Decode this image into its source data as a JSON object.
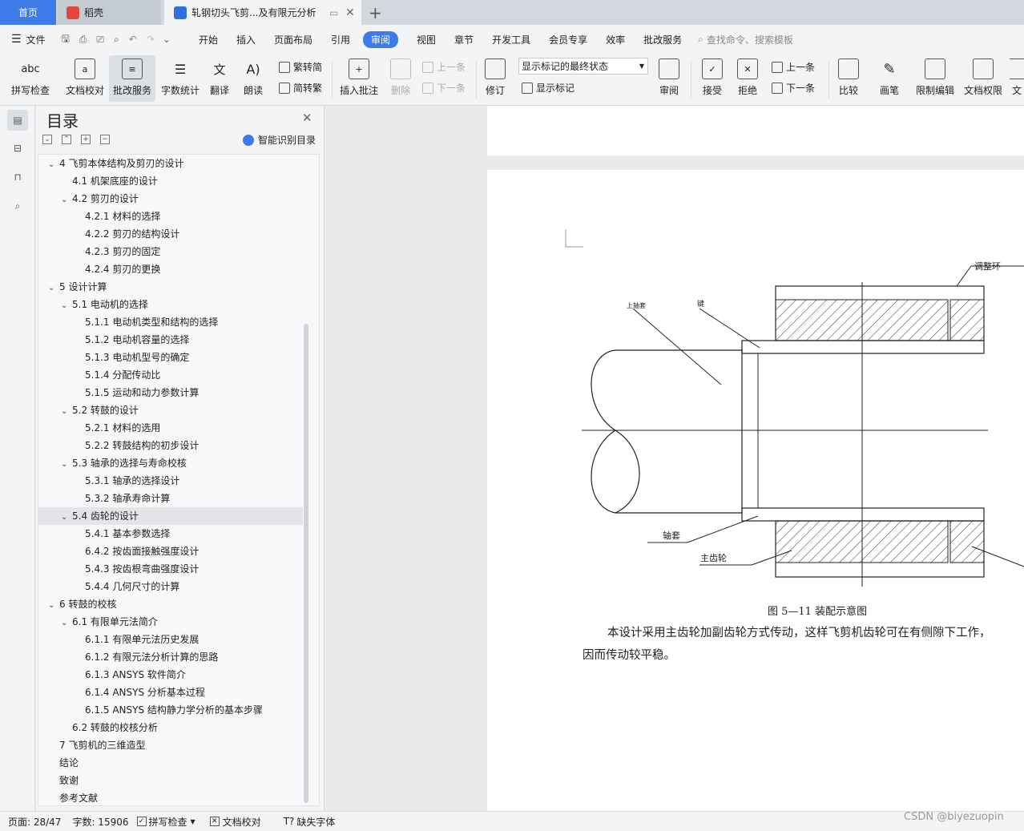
{
  "tabs": {
    "home": "首页",
    "wps": "稻壳",
    "doc": "轧钢切头飞剪...及有限元分析"
  },
  "menu": {
    "file": "文件",
    "items": [
      "开始",
      "插入",
      "页面布局",
      "引用",
      "审阅",
      "视图",
      "章节",
      "开发工具",
      "会员专享",
      "效率",
      "批改服务"
    ],
    "active_index": 4,
    "search_placeholder": "查找命令、搜索模板"
  },
  "ribbon": {
    "spell": "拼写检查",
    "doc_check": "文档校对",
    "revise_service": "批改服务",
    "word_count": "字数统计",
    "translate": "翻译",
    "read": "朗读",
    "trad_to_simp": "繁转简",
    "simp_to_trad": "简转繁",
    "insert_comment": "插入批注",
    "delete": "删除",
    "prev": "上一条",
    "next": "下一条",
    "track": "修订",
    "markup_state": "显示标记的最终状态",
    "show_markup": "显示标记",
    "review": "审阅",
    "accept": "接受",
    "reject": "拒绝",
    "prev2": "上一条",
    "next2": "下一条",
    "compare": "比较",
    "pen": "画笔",
    "restrict": "限制编辑",
    "doc_perm": "文档权限",
    "doc_more": "文"
  },
  "toc": {
    "title": "目录",
    "smart": "智能识别目录",
    "items": [
      {
        "text": "4  飞剪本体结构及剪刃的设计",
        "level": 0,
        "caret": "v"
      },
      {
        "text": "4.1 机架底座的设计",
        "level": 1,
        "caret": ""
      },
      {
        "text": "4.2 剪刃的设计",
        "level": 1,
        "caret": "v"
      },
      {
        "text": "4.2.1 材料的选择",
        "level": 2,
        "caret": ""
      },
      {
        "text": "4.2.2 剪刃的结构设计",
        "level": 2,
        "caret": ""
      },
      {
        "text": "4.2.3 剪刃的固定",
        "level": 2,
        "caret": ""
      },
      {
        "text": "4.2.4  剪刃的更换",
        "level": 2,
        "caret": ""
      },
      {
        "text": "5  设计计算",
        "level": 0,
        "caret": "v"
      },
      {
        "text": "5.1 电动机的选择",
        "level": 1,
        "caret": "v"
      },
      {
        "text": "5.1.1 电动机类型和结构的选择",
        "level": 2,
        "caret": ""
      },
      {
        "text": "5.1.2  电动机容量的选择",
        "level": 2,
        "caret": ""
      },
      {
        "text": "5.1.3  电动机型号的确定",
        "level": 2,
        "caret": ""
      },
      {
        "text": "5.1.4  分配传动比",
        "level": 2,
        "caret": ""
      },
      {
        "text": "5.1.5  运动和动力参数计算",
        "level": 2,
        "caret": ""
      },
      {
        "text": "5.2  转鼓的设计",
        "level": 1,
        "caret": "v"
      },
      {
        "text": "5.2.1  材料的选用",
        "level": 2,
        "caret": ""
      },
      {
        "text": "5.2.2  转鼓结构的初步设计",
        "level": 2,
        "caret": ""
      },
      {
        "text": "5.3 轴承的选择与寿命校核",
        "level": 1,
        "caret": "v"
      },
      {
        "text": "5.3.1  轴承的选择设计",
        "level": 2,
        "caret": ""
      },
      {
        "text": "5.3.2  轴承寿命计算",
        "level": 2,
        "caret": ""
      },
      {
        "text": "5.4  齿轮的设计",
        "level": 1,
        "caret": "v",
        "current": true
      },
      {
        "text": "5.4.1  基本参数选择",
        "level": 2,
        "caret": ""
      },
      {
        "text": "6.4.2  按齿面接触强度设计",
        "level": 2,
        "caret": ""
      },
      {
        "text": "5.4.3 按齿根弯曲强度设计",
        "level": 2,
        "caret": ""
      },
      {
        "text": "5.4.4  几何尺寸的计算",
        "level": 2,
        "caret": ""
      },
      {
        "text": "6  转鼓的校核",
        "level": 0,
        "caret": "v"
      },
      {
        "text": "6.1 有限单元法简介",
        "level": 1,
        "caret": "v"
      },
      {
        "text": "6.1.1  有限单元法历史发展",
        "level": 2,
        "caret": ""
      },
      {
        "text": "6.1.2 有限元法分析计算的思路",
        "level": 2,
        "caret": ""
      },
      {
        "text": "6.1.3    ANSYS 软件简介",
        "level": 2,
        "caret": ""
      },
      {
        "text": "6.1.4    ANSYS 分析基本过程",
        "level": 2,
        "caret": ""
      },
      {
        "text": "6.1.5 ANSYS 结构静力学分析的基本步骤",
        "level": 2,
        "caret": ""
      },
      {
        "text": "6.2  转鼓的校核分析",
        "level": 1,
        "caret": ""
      },
      {
        "text": "7 飞剪机的三维造型",
        "level": 0,
        "caret": ""
      },
      {
        "text": "结论",
        "level": 0,
        "caret": ""
      },
      {
        "text": "致谢",
        "level": 0,
        "caret": ""
      },
      {
        "text": "参考文献",
        "level": 0,
        "caret": ""
      }
    ]
  },
  "drawing": {
    "labels": {
      "adjust_ring": "调整环",
      "upper_sleeve": "上轴套",
      "key": "键",
      "sleeve": "轴套",
      "main_gear": "主齿轮"
    }
  },
  "document": {
    "caption": "图 5—11  装配示意图",
    "para1": "本设计采用主齿轮加副齿轮方式传动，这样飞剪机齿轮可在有侧隙下工作，",
    "para2": "因而传动较平稳。"
  },
  "status": {
    "page": "页面: 28/47",
    "words": "字数: 15906",
    "spell": "拼写检查",
    "doc_check": "文档校对",
    "missing_font": "缺失字体"
  },
  "watermark": "CSDN @biyezuopin"
}
